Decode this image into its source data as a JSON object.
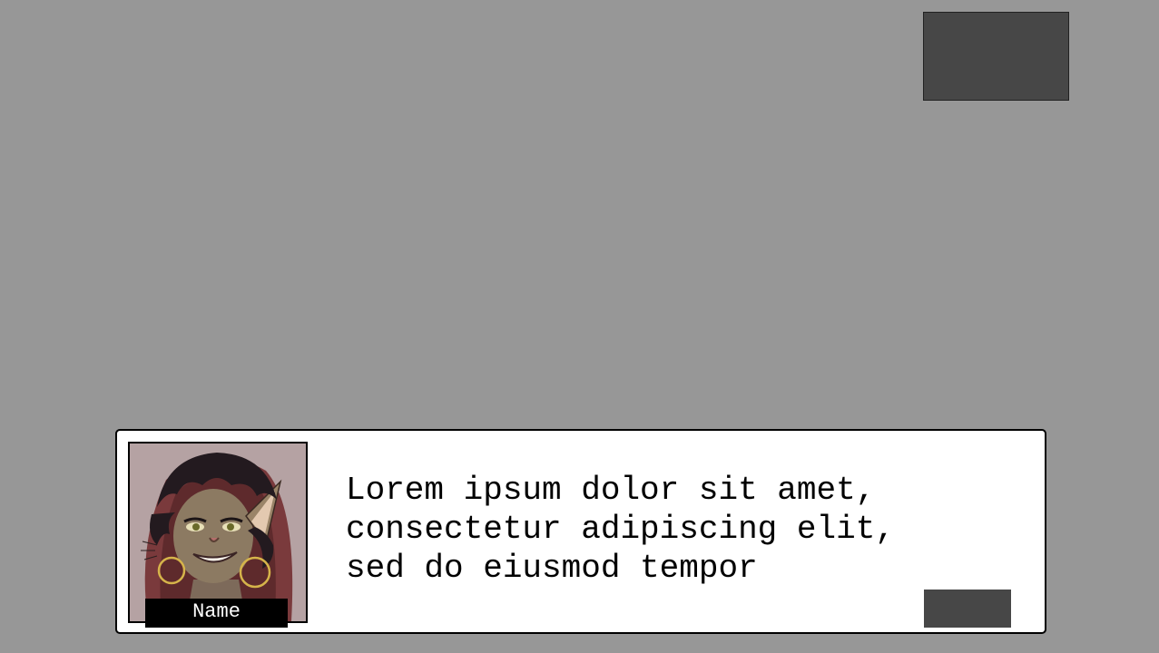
{
  "speaker": {
    "name": "Name",
    "portrait": "character-portrait"
  },
  "dialogue": {
    "lines": [
      "Lorem ipsum dolor sit amet,",
      "consectetur adipiscing elit,",
      "sed do eiusmod tempor"
    ]
  },
  "colors": {
    "background": "#979797",
    "panel": "#474747",
    "dialogue_box": "#ffffff",
    "name_plate": "#000000"
  }
}
